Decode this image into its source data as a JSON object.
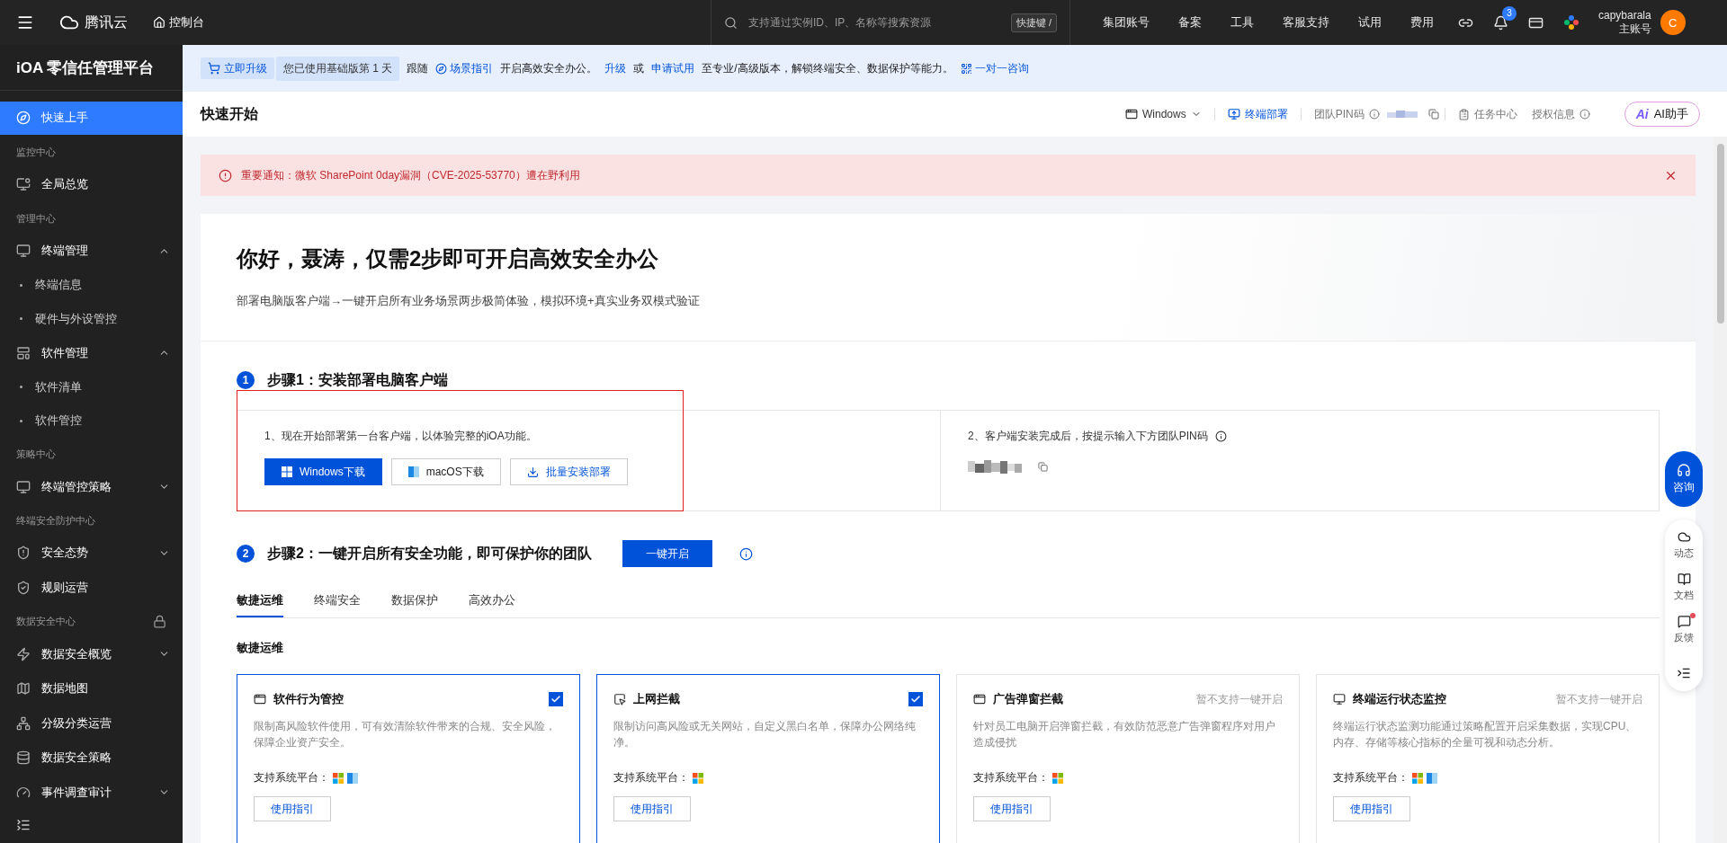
{
  "topbar": {
    "brand": "腾讯云",
    "console": "控制台",
    "search": {
      "placeholder": "支持通过实例ID、IP、名称等搜索资源"
    },
    "shortcut": "快捷键 /",
    "nav": [
      "集团账号",
      "备案",
      "工具",
      "客服支持",
      "试用",
      "费用"
    ],
    "notifications": "3",
    "user": {
      "name": "capybarala",
      "role": "主账号",
      "avatar": "C"
    }
  },
  "sidebar": {
    "title": "iOA 零信任管理平台",
    "items": [
      {
        "kind": "item",
        "label": "快速上手",
        "selected": true
      },
      {
        "kind": "group",
        "label": "监控中心"
      },
      {
        "kind": "item",
        "label": "全局总览",
        "selected": false
      },
      {
        "kind": "group",
        "label": "管理中心"
      },
      {
        "kind": "item",
        "label": "终端管理",
        "selected": false,
        "expanded": true,
        "children": [
          {
            "label": "终端信息",
            "selected": false
          },
          {
            "label": "硬件与外设管控",
            "selected": false
          }
        ]
      },
      {
        "kind": "item",
        "label": "软件管理",
        "selected": false,
        "expanded": true,
        "children": [
          {
            "label": "软件清单",
            "selected": false
          },
          {
            "label": "软件管控",
            "selected": false
          }
        ]
      },
      {
        "kind": "group",
        "label": "策略中心"
      },
      {
        "kind": "item",
        "label": "终端管控策略",
        "selected": false,
        "expanded": false
      },
      {
        "kind": "group",
        "label": "终端安全防护中心"
      },
      {
        "kind": "item",
        "label": "安全态势",
        "selected": false,
        "expanded": false
      },
      {
        "kind": "item",
        "label": "规则运营",
        "selected": false
      },
      {
        "kind": "group",
        "label": "数据安全中心",
        "locked": true
      },
      {
        "kind": "item",
        "label": "数据安全概览",
        "selected": false,
        "expanded": false
      },
      {
        "kind": "item",
        "label": "数据地图",
        "selected": false
      },
      {
        "kind": "item",
        "label": "分级分类运营",
        "selected": false
      },
      {
        "kind": "item",
        "label": "数据安全策略",
        "selected": false
      },
      {
        "kind": "item",
        "label": "事件调查审计",
        "selected": false,
        "expanded": false
      }
    ]
  },
  "upgrade_bar": [
    {
      "kind": "button",
      "text": "立即升级"
    },
    {
      "kind": "badge",
      "text": "您已使用基础版第 1 天"
    },
    {
      "kind": "text",
      "text": "跟随"
    },
    {
      "kind": "link",
      "text": "场景指引"
    },
    {
      "kind": "text",
      "text": "开启高效安全办公。"
    },
    {
      "kind": "link",
      "text": "升级"
    },
    {
      "kind": "text",
      "text": "或"
    },
    {
      "kind": "link",
      "text": "申请试用"
    },
    {
      "kind": "text",
      "text": "至专业/高级版本，解锁终端安全、数据保护等能力。"
    },
    {
      "kind": "link",
      "text": "一对一咨询"
    }
  ],
  "header": {
    "title": "快速开始",
    "os": "Windows",
    "deploy": "终端部署",
    "pin_label": "团队PIN码",
    "tasks": "任务中心",
    "license": "授权信息",
    "ai": {
      "badge": "Ai",
      "label": "AI助手"
    }
  },
  "alert": {
    "text": "重要通知：微软 SharePoint 0day漏洞（CVE-2025-53770）遭在野利用"
  },
  "hero": {
    "title": "你好，聂涛，仅需2步即可开启高效安全办公",
    "subtitle": "部署电脑版客户端→一键开启所有业务场景两步极简体验，模拟环境+真实业务双模式验证"
  },
  "step1": {
    "number": "1",
    "title": "步骤1：安装部署电脑客户端",
    "left_text": "1、现在开始部署第一台客户端，以体验完整的iOA功能。",
    "buttons": [
      {
        "kind": "primary",
        "text": "Windows下载"
      },
      {
        "kind": "default",
        "text": "macOS下载"
      },
      {
        "kind": "link",
        "text": "批量安装部署"
      }
    ],
    "right_text": "2、客户端安装完成后，按提示输入下方团队PIN码"
  },
  "step2": {
    "number": "2",
    "title": "步骤2：一键开启所有安全功能，即可保护你的团队",
    "button": "一键开启"
  },
  "tabs": [
    {
      "label": "敏捷运维",
      "selected": true
    },
    {
      "label": "终端安全",
      "selected": false
    },
    {
      "label": "数据保护",
      "selected": false
    },
    {
      "label": "高效办公",
      "selected": false
    }
  ],
  "section_title": "敏捷运维",
  "cards": [
    {
      "kind": "checkable",
      "title": "软件行为管控",
      "checked": true,
      "description": "限制高风险软件使用，可有效清除软件带来的合规、安全风险，保障企业资产安全。",
      "platform_label": "支持系统平台：",
      "mac_supported": true,
      "button": "使用指引"
    },
    {
      "kind": "checkable",
      "title": "上网拦截",
      "checked": true,
      "description": "限制访问高风险或无关网站，自定义黑白名单，保障办公网络纯净。",
      "platform_label": "支持系统平台：",
      "mac_supported": false,
      "button": "使用指引"
    },
    {
      "kind": "unsupported",
      "title": "广告弹窗拦截",
      "note": "暂不支持一键开启",
      "description": "针对员工电脑开启弹窗拦截，有效防范恶意广告弹窗程序对用户造成侵扰",
      "platform_label": "支持系统平台：",
      "mac_supported": false,
      "button": "使用指引"
    },
    {
      "kind": "unsupported",
      "title": "终端运行状态监控",
      "note": "暂不支持一键开启",
      "description": "终端运行状态监测功能通过策略配置开启采集数据，实现CPU、内存、存储等核心指标的全量可视和动态分析。",
      "platform_label": "支持系统平台：",
      "mac_supported": true,
      "button": "使用指引"
    }
  ],
  "float": {
    "consult": "咨询",
    "items": [
      {
        "label": "动态",
        "unread": false
      },
      {
        "label": "文档",
        "unread": false
      },
      {
        "label": "反馈",
        "unread": true
      }
    ]
  }
}
